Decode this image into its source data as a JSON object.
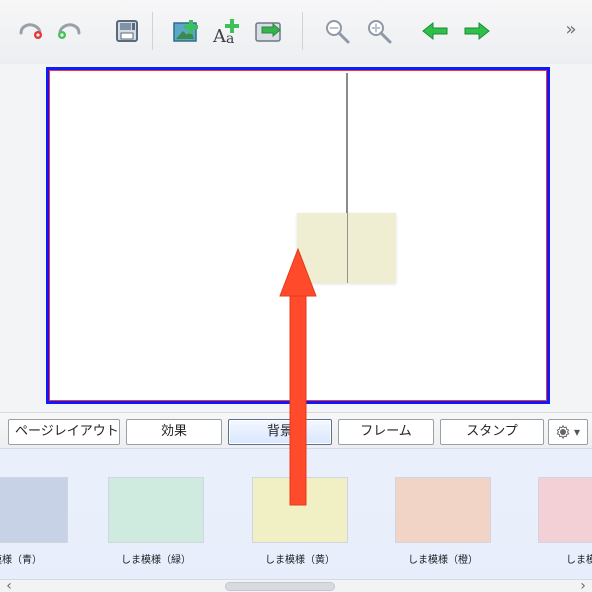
{
  "toolbar": {
    "overflow_glyph": "»",
    "buttons": [
      {
        "name": "undo-icon"
      },
      {
        "name": "redo-icon"
      },
      {
        "name": "save-icon"
      },
      {
        "name": "add-image-icon"
      },
      {
        "name": "add-text-icon"
      },
      {
        "name": "import-icon"
      },
      {
        "name": "zoom-out-icon"
      },
      {
        "name": "zoom-in-icon"
      },
      {
        "name": "previous-page-icon"
      },
      {
        "name": "next-page-icon"
      }
    ]
  },
  "tabs": [
    {
      "label": "ページレイアウト"
    },
    {
      "label": "効果"
    },
    {
      "label": "背景",
      "active": true
    },
    {
      "label": "フレーム"
    },
    {
      "label": "スタンプ"
    }
  ],
  "tab_gear": {
    "icon": "gear-icon",
    "chevron": "▾"
  },
  "backgrounds": [
    {
      "label": "縞模様（青）",
      "color": "#c7d2e7"
    },
    {
      "label": "しま模様（緑）",
      "color": "#cfeadf"
    },
    {
      "label": "しま模様（黄）",
      "color": "#f1efc4"
    },
    {
      "label": "しま模様（橙）",
      "color": "#f2d4c6"
    },
    {
      "label": "しま模様",
      "color": "#f2d0d6"
    }
  ],
  "scrollbar": {
    "left_arrow": "‹",
    "right_arrow": "›"
  },
  "colors": {
    "page_border_blue": "#0a1cff",
    "page_border_red": "#ff3030",
    "arrow_red": "#ff4b2b"
  }
}
